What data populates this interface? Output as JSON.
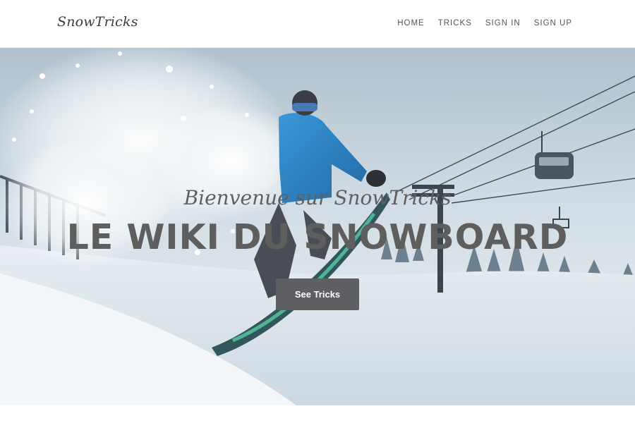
{
  "navbar": {
    "brand": "SnowTricks",
    "links": [
      {
        "label": "HOME"
      },
      {
        "label": "TRICKS"
      },
      {
        "label": "SIGN IN"
      },
      {
        "label": "SIGN UP"
      }
    ]
  },
  "hero": {
    "subtitle": "Bienvenue sur SnowTricks",
    "title": "LE WIKI DU SNOWBOARD",
    "button_label": "See Tricks"
  },
  "colors": {
    "text_dark": "#3a3a3a",
    "hero_text": "#5e5e5e",
    "button_bg": "#5e5f62",
    "snowboarder_jacket": "#1f7fc4"
  }
}
